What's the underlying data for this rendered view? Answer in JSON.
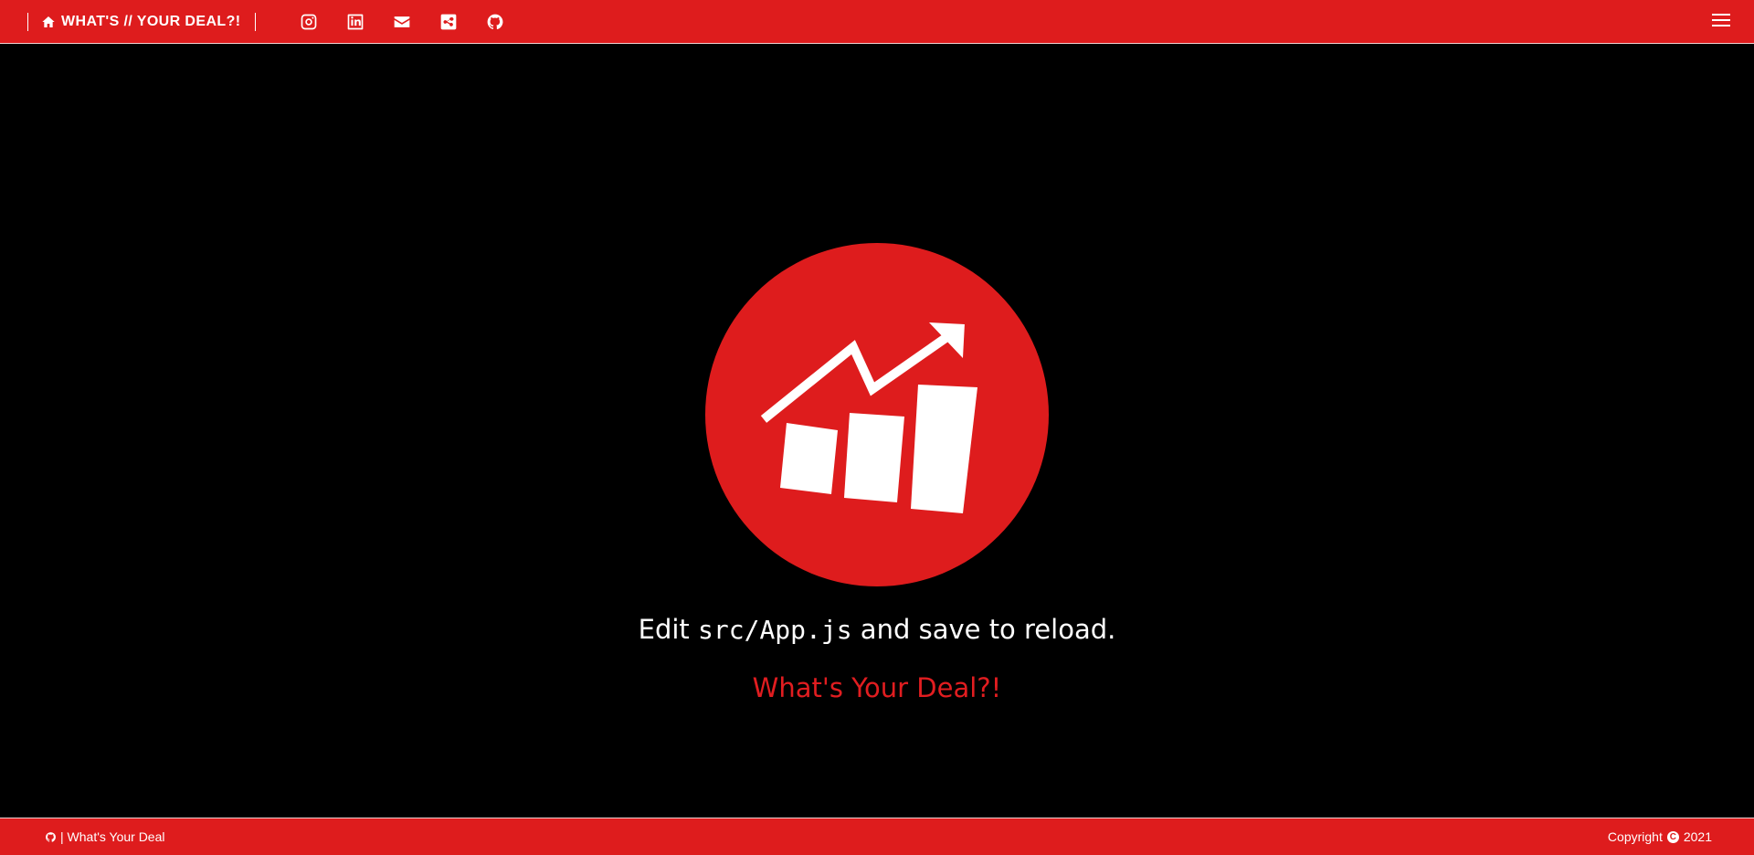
{
  "header": {
    "brand_label": "WHAT'S // YOUR DEAL?!",
    "home_icon": "home-icon",
    "socials": [
      {
        "name": "instagram",
        "icon": "instagram-icon"
      },
      {
        "name": "linkedin",
        "icon": "linkedin-icon"
      },
      {
        "name": "email",
        "icon": "envelope-icon"
      },
      {
        "name": "share",
        "icon": "share-icon"
      },
      {
        "name": "github",
        "icon": "github-icon"
      }
    ],
    "menu_icon": "hamburger-menu-icon",
    "background_color": "#de1c1d"
  },
  "main": {
    "logo_icon": "growth-chart-logo",
    "edit_prefix": "Edit ",
    "edit_code": "src/App.js",
    "edit_suffix": " and save to reload.",
    "deal_link": "What's Your Deal?!",
    "link_color": "#e11d20"
  },
  "footer": {
    "left_icon": "github-icon",
    "left_text": "| What's Your Deal",
    "copyright_label": "Copyright",
    "copyright_icon": "copyright-icon",
    "copyright_year": "2021"
  }
}
